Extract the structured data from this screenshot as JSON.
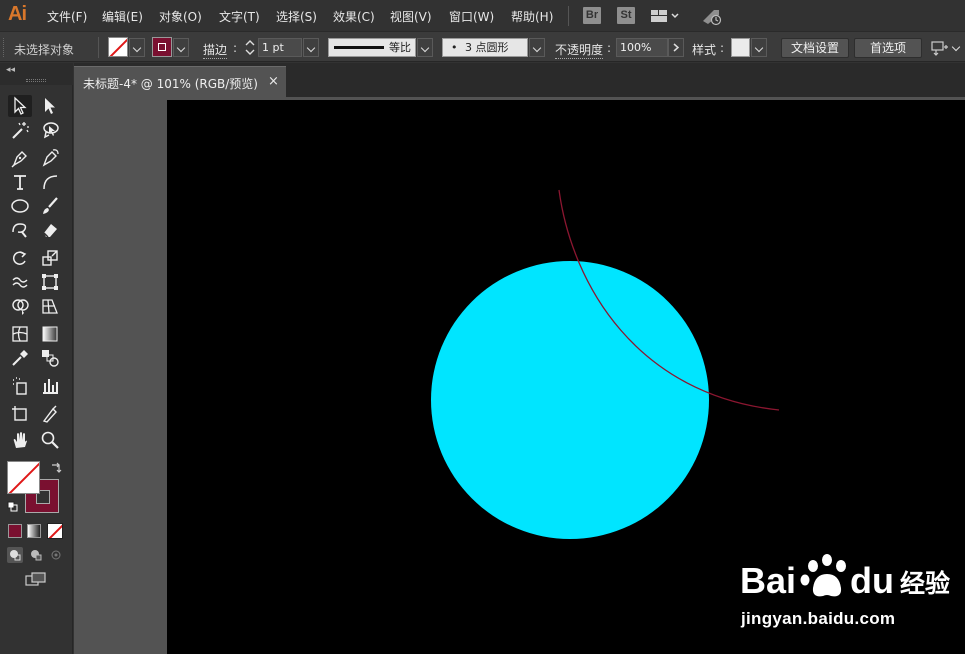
{
  "app": {
    "logo": "Ai"
  },
  "menu": [
    "文件(F)",
    "编辑(E)",
    "对象(O)",
    "文字(T)",
    "选择(S)",
    "效果(C)",
    "视图(V)",
    "窗口(W)",
    "帮助(H)"
  ],
  "menubar_buttons": {
    "bridge": "Br",
    "stock": "St"
  },
  "control_bar": {
    "selection_status": "未选择对象",
    "stroke_label": "描边",
    "stroke_weight": "1 pt",
    "stroke_profile": "等比",
    "brush_dot": "•",
    "brush": "3 点圆形",
    "opacity_label": "不透明度",
    "opacity": "100%",
    "style_label": "样式",
    "doc_setup": "文档设置",
    "preferences": "首选项"
  },
  "document_tab": {
    "title": "未标题-4* @ 101% (RGB/预览)",
    "close": "×"
  },
  "artboard": {
    "background": "#000000",
    "circle_fill": "#00e5ff",
    "arc_stroke": "#8b1630"
  },
  "toolbar": {
    "fill_stroke_colors": {
      "fill": "#ffffff",
      "stroke": "#7a1030"
    },
    "mode_colors": [
      "#7a1030"
    ]
  },
  "watermark": {
    "brand": "Baidu",
    "brand_cn": "经验",
    "url": "jingyan.baidu.com"
  },
  "colors": {
    "accent": "#d9772b",
    "cyan": "#00e5ff",
    "maroon": "#7a1030"
  }
}
